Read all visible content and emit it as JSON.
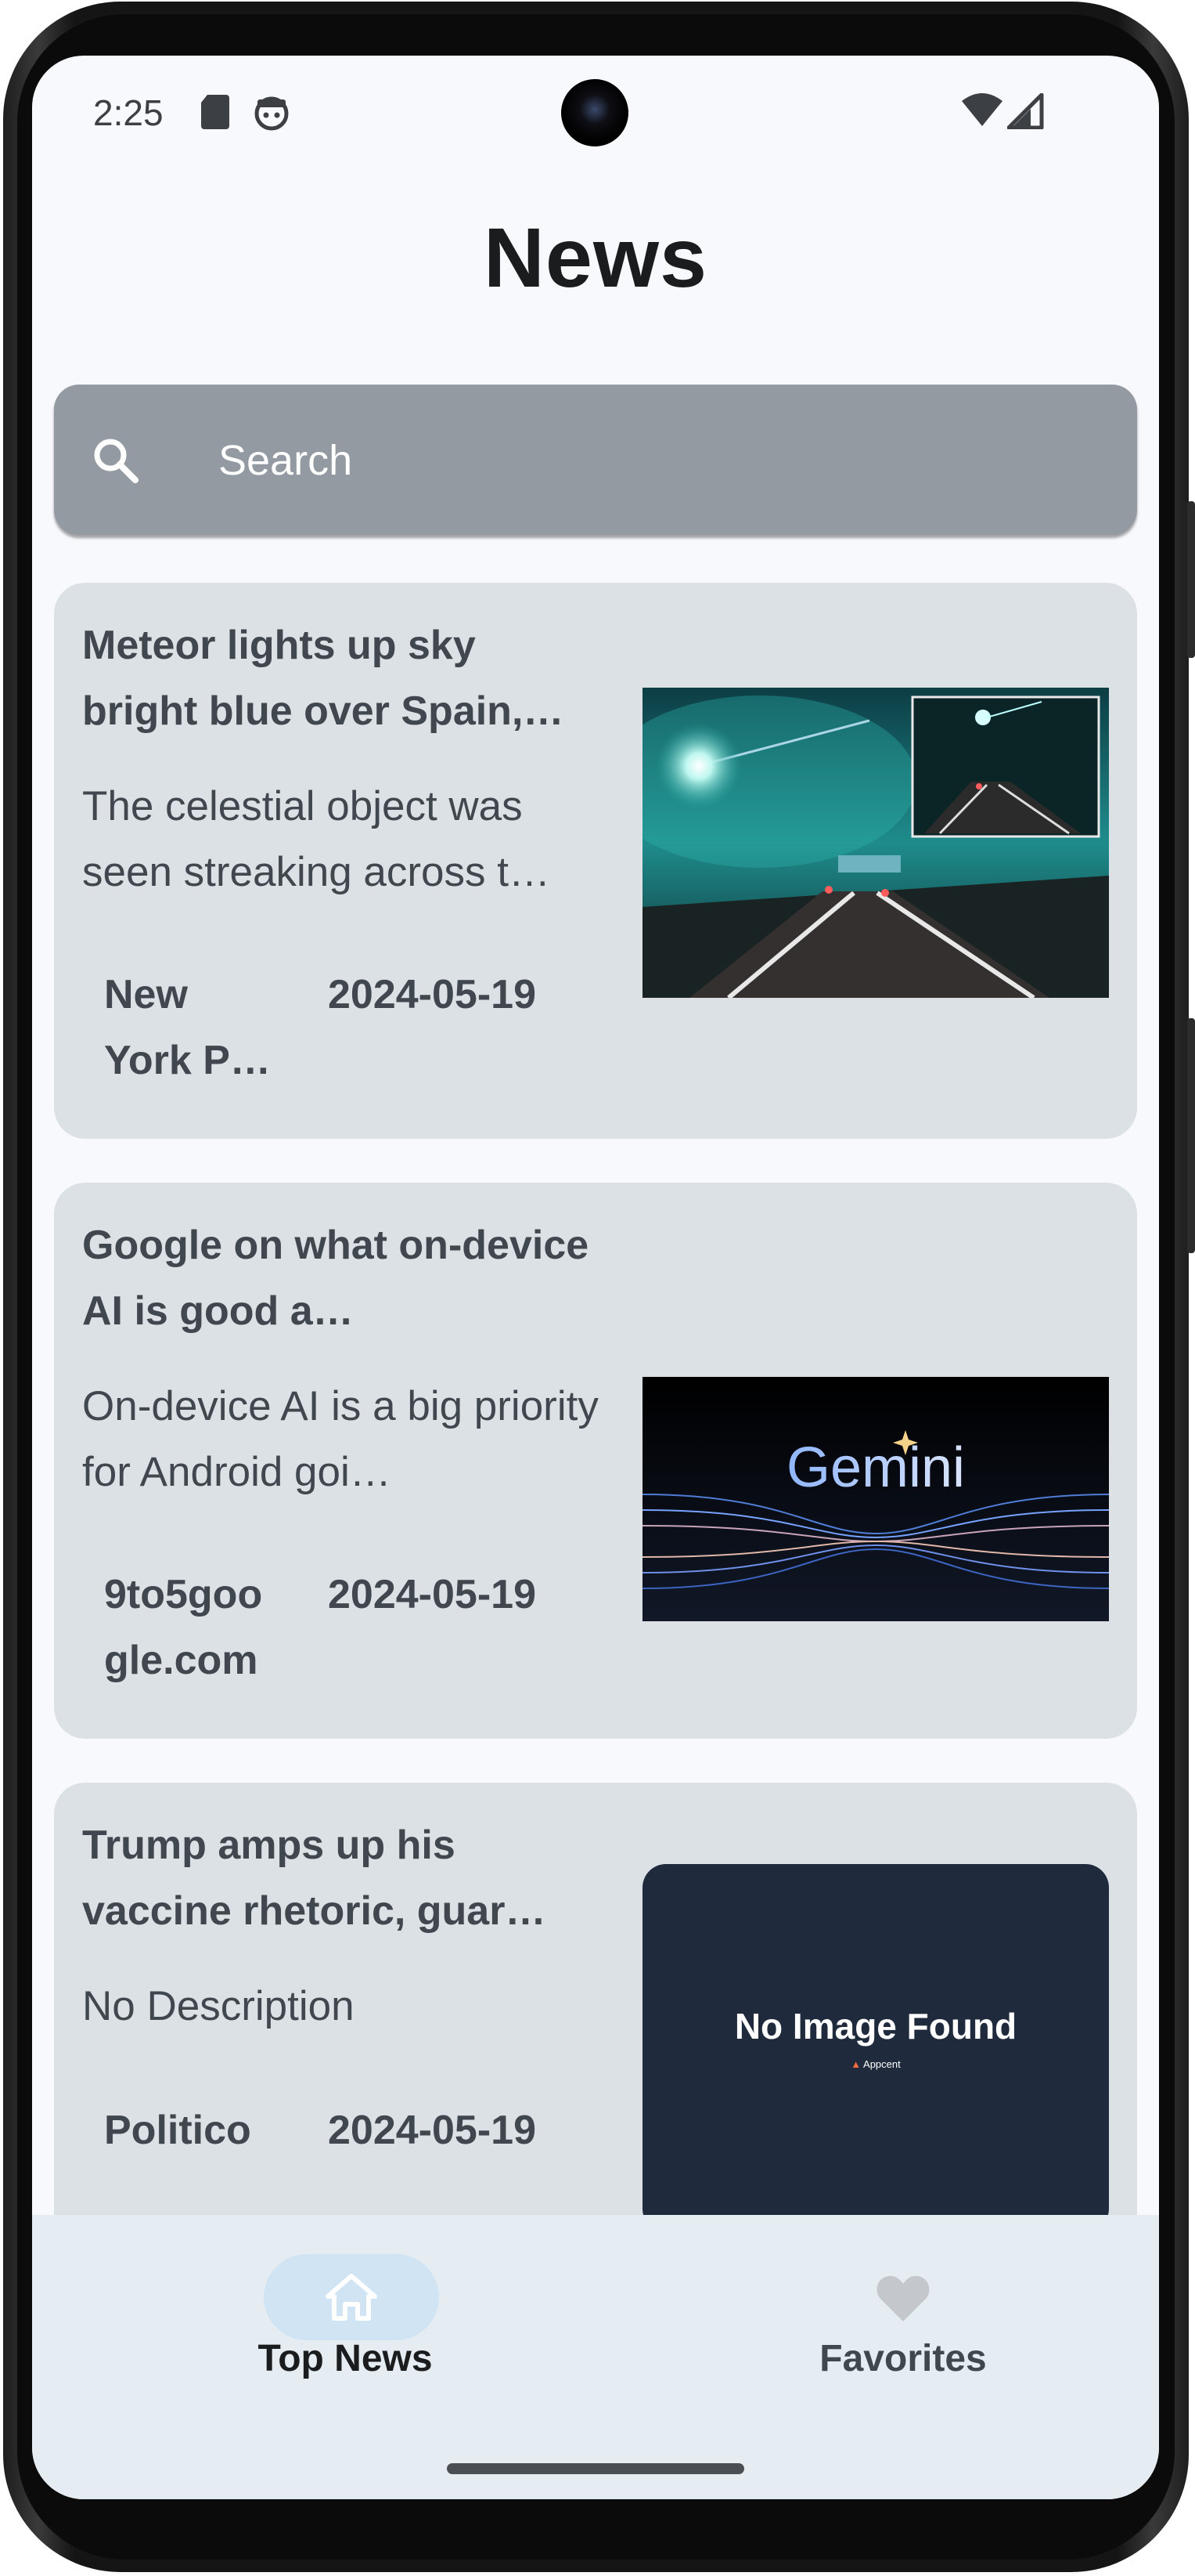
{
  "status_bar": {
    "time": "2:25",
    "icons": [
      "sd-card-icon",
      "robot-face-icon",
      "wifi-icon",
      "cellular-signal-icon"
    ]
  },
  "header": {
    "title": "News"
  },
  "search": {
    "placeholder": "Search"
  },
  "articles": [
    {
      "title": "Meteor lights up sky bright blue over Spain,…",
      "description": "The celestial object was seen streaking across t…",
      "source": "New York P…",
      "date": "2024-05-19",
      "image": "meteor-highway-photo"
    },
    {
      "title": "Google on what on-device AI is good a…",
      "description": "On-device AI is a big priority for Android goi…",
      "source": "9to5google.com",
      "date": "2024-05-19",
      "image": "gemini-banner",
      "image_text": "Gemini"
    },
    {
      "title": "Trump amps up his vaccine rhetoric, guar…",
      "description": "No Description",
      "source": "Politico",
      "date": "2024-05-19",
      "image": "no-image-placeholder",
      "image_text": "No Image Found",
      "image_brand": "Appcent"
    }
  ],
  "bottom_nav": {
    "items": [
      {
        "label": "Top News",
        "icon": "home-icon",
        "selected": true
      },
      {
        "label": "Favorites",
        "icon": "heart-icon",
        "selected": false
      }
    ]
  },
  "colors": {
    "screen_background": "#f8f9fc",
    "search_background": "#939aa2",
    "card_background": "#dce1e6",
    "nav_background": "#e6edf2",
    "nav_selected_pill": "#d0e4f4",
    "text_primary": "#41474e"
  }
}
